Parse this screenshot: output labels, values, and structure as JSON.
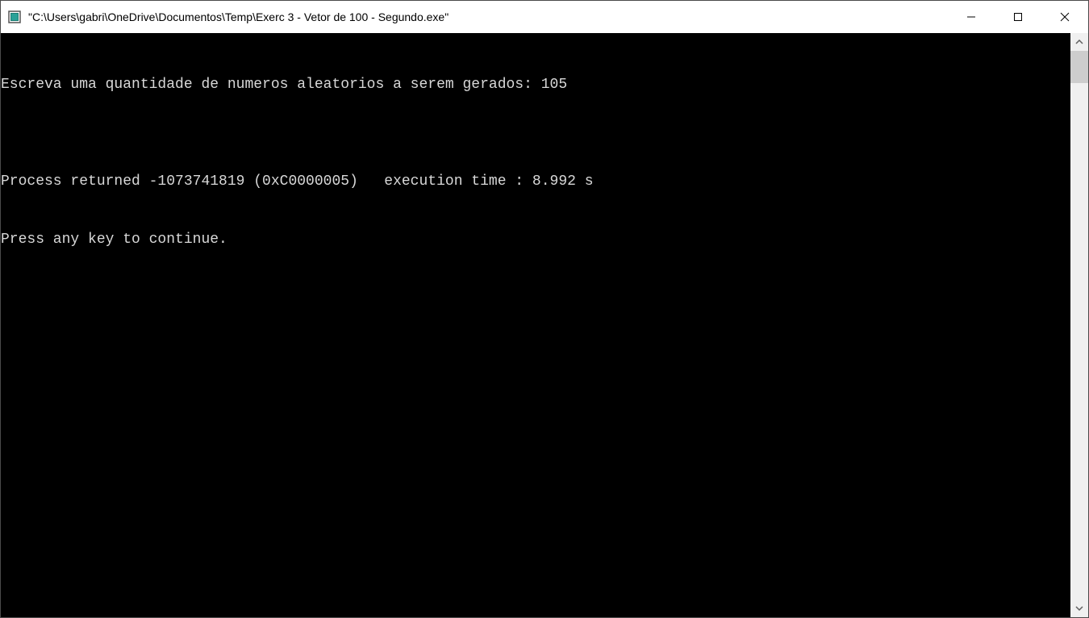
{
  "titlebar": {
    "title": "\"C:\\Users\\gabri\\OneDrive\\Documentos\\Temp\\Exerc 3 - Vetor de 100 - Segundo.exe\""
  },
  "console": {
    "lines": [
      "Escreva uma quantidade de numeros aleatorios a serem gerados: 105",
      "",
      "Process returned -1073741819 (0xC0000005)   execution time : 8.992 s",
      "Press any key to continue."
    ]
  }
}
